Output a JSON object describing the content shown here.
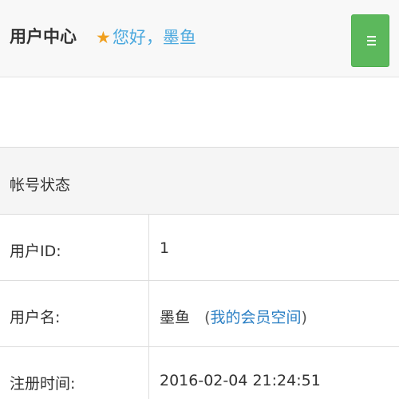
{
  "header": {
    "brand": "用户中心",
    "greeting": "您好，墨鱼",
    "menu_icon": "hamburger-icon",
    "star_icon": "star-icon"
  },
  "colors": {
    "menu_button": "#5cb85c",
    "greeting": "#4aa8de",
    "star": "#f0a020",
    "link": "#2a7fc4"
  },
  "account": {
    "title": "帐号状态",
    "rows": [
      {
        "label": "用户ID:",
        "value": "1"
      },
      {
        "label": "用户名:",
        "value": "墨鱼",
        "link_open": "(",
        "link": "我的会员空间",
        "link_close": ")"
      },
      {
        "label": "注册时间:",
        "value": "2016-02-04 21:24:51"
      }
    ]
  }
}
